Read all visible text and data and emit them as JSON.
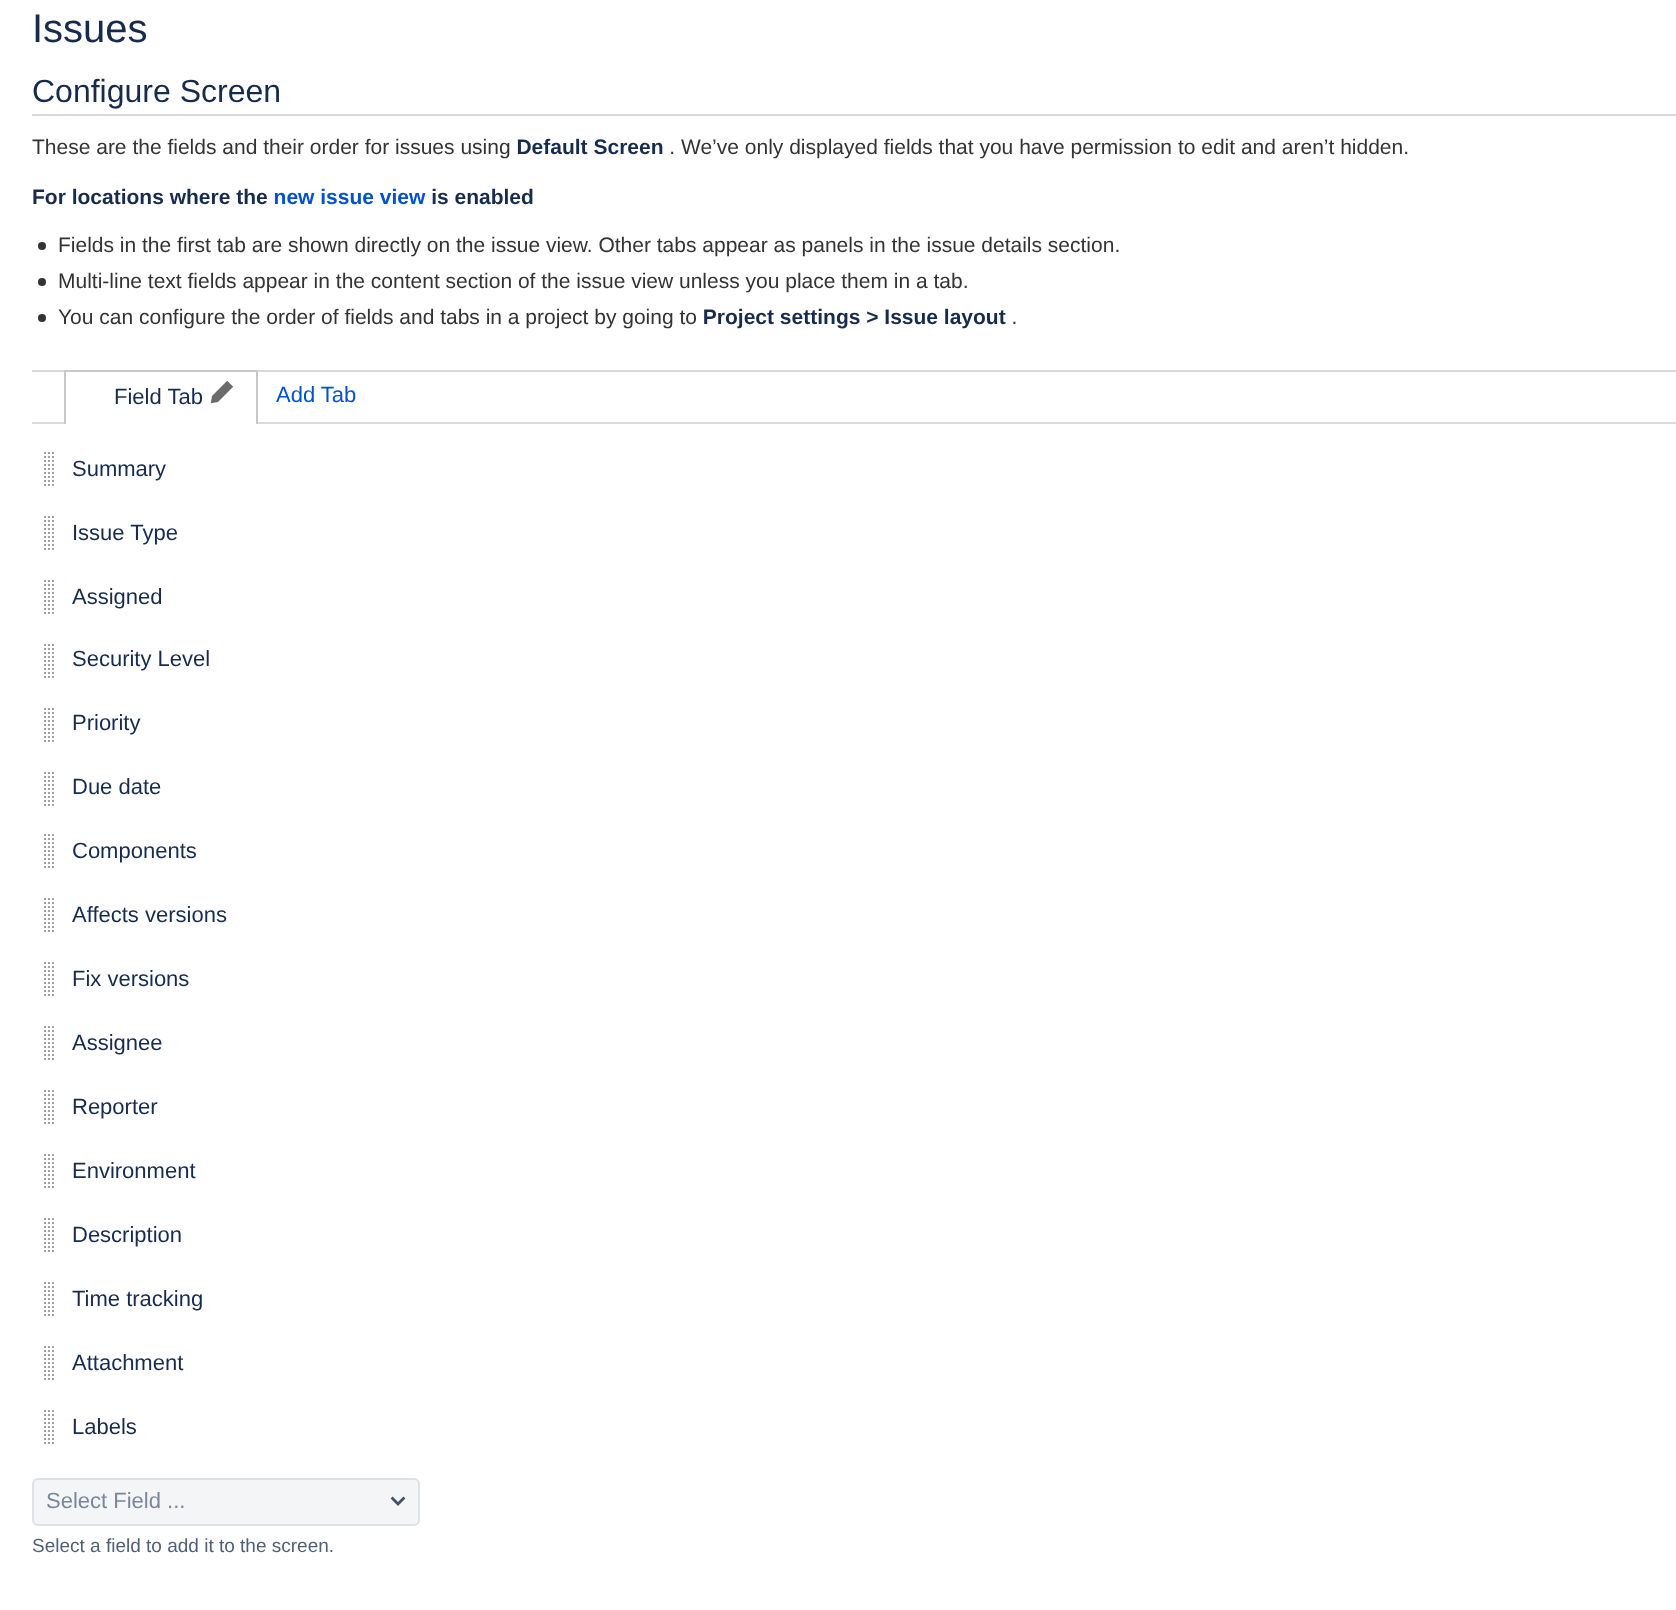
{
  "page": {
    "title": "Issues"
  },
  "screen": {
    "title": "Configure Screen",
    "description": "These are the fields and their order for issues using **Default Screen** . We’ve only displayed fields that you have permission to edit and aren’t hidden."
  },
  "notice": {
    "text_before": "For locations where the",
    "link": "new issue view",
    "text_after": "is enabled"
  },
  "bullets": [
    "Fields in the first tab are shown directly on the issue view. Other tabs appear as panels in the issue details section.",
    "Multi-line text fields appear in the content section of the issue view unless you place them in a tab.",
    "You can configure the order of fields and tabs in a project by going to **Project settings > Issue layout** ."
  ],
  "tabs": [
    {
      "label": "Field Tab",
      "selected": true
    }
  ],
  "add_tab": {
    "label": "Add Tab"
  },
  "fields": [
    "Summary",
    "Issue Type",
    "Assigned",
    "Security Level",
    "Priority",
    "Due date",
    "Components",
    "Affects versions",
    "Fix versions",
    "Assignee",
    "Reporter",
    "Environment",
    "Description",
    "Time tracking",
    "Attachment",
    "Labels"
  ],
  "field_select": {
    "placeholder": "Select Field ...",
    "hint": "Select a field to add it to the screen."
  }
}
